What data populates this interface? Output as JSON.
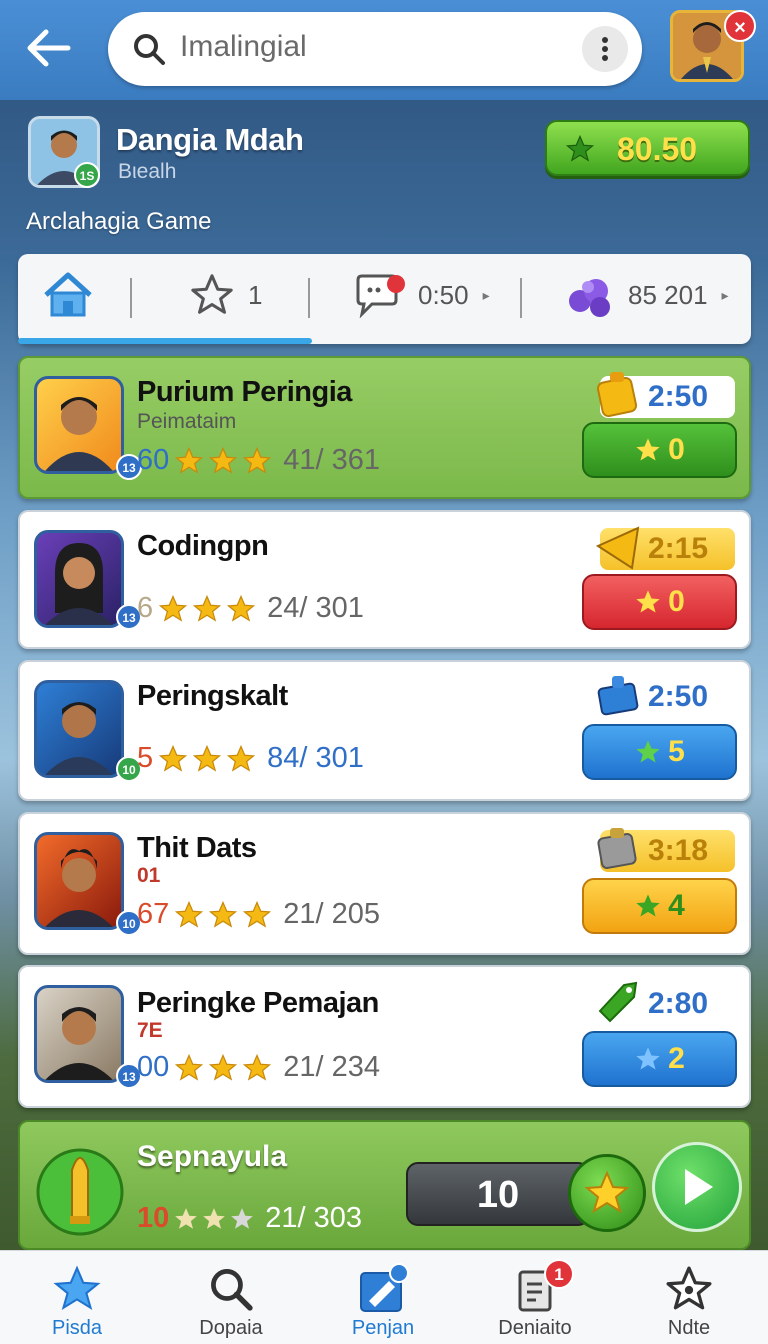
{
  "topbar": {
    "search_text": "Imalingial"
  },
  "profile": {
    "name": "Dangia Mdah",
    "subtitle": "Bιealh",
    "level": "1S",
    "coins": "80.50",
    "game_title": "Arclahagia Game"
  },
  "tabs": [
    {
      "icon": "home-icon",
      "label": ""
    },
    {
      "icon": "star-icon",
      "label": "1"
    },
    {
      "icon": "chat-icon",
      "label": "0:50"
    },
    {
      "icon": "gem-icon",
      "label": "85 201"
    }
  ],
  "players": [
    {
      "name": "Purium Peringia",
      "sub": "Peimataim",
      "level_badge": "13",
      "prefix": "60",
      "count": "41/ 361",
      "timer": "2:50",
      "action_value": "0",
      "style": "green"
    },
    {
      "name": "Codingpn",
      "sub": "",
      "level_badge": "13",
      "prefix": "6",
      "count": "24/ 301",
      "timer": "2:15",
      "action_value": "0",
      "style": "red"
    },
    {
      "name": "Peringskalt",
      "sub": "",
      "level_badge": "10",
      "prefix": "5",
      "count": "84/ 301",
      "timer": "2:50",
      "action_value": "5",
      "style": "blue"
    },
    {
      "name": "Thit Dats",
      "sub": "01",
      "level_badge": "10",
      "prefix": "67",
      "count": "21/ 205",
      "timer": "3:18",
      "action_value": "4",
      "style": "yellow"
    },
    {
      "name": "Peringke Pemajan",
      "sub": "7E",
      "level_badge": "13",
      "prefix": "00",
      "count": "21/ 234",
      "timer": "2:80",
      "action_value": "2",
      "style": "blue"
    }
  ],
  "promo": {
    "name": "Sepnayula",
    "prefix": "10",
    "count": "21/ 303",
    "counter": "10"
  },
  "bottomnav": [
    {
      "label": "Pisda",
      "icon": "star-icon",
      "active": true
    },
    {
      "label": "Dopaia",
      "icon": "search-icon"
    },
    {
      "label": "Penjan",
      "icon": "edit-icon",
      "active": true
    },
    {
      "label": "Deniaito",
      "icon": "document-icon",
      "badge": "1"
    },
    {
      "label": "Ndte",
      "icon": "star-outline-icon"
    }
  ],
  "colors": {
    "topbar": "#3b7cc0",
    "accent_blue": "#1f7ad1",
    "green": "#41a61f",
    "red": "#d6262f",
    "gold": "#ffe04a"
  }
}
